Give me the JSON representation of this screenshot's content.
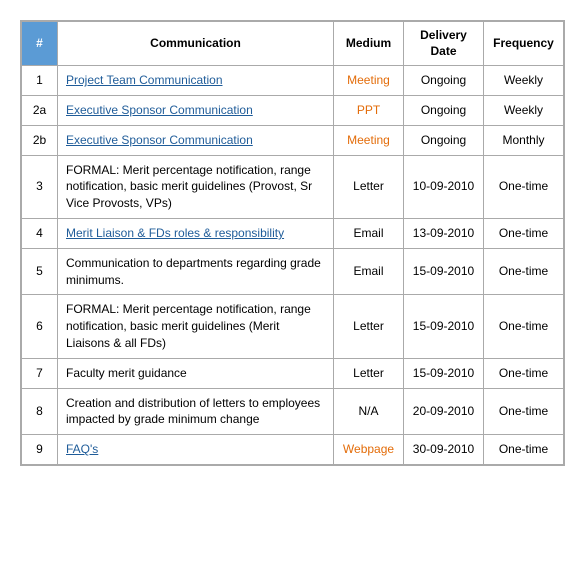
{
  "table": {
    "headers": {
      "num": "#",
      "communication": "Communication",
      "medium": "Medium",
      "delivery_date": "Delivery Date",
      "frequency": "Frequency"
    },
    "rows": [
      {
        "num": "1",
        "communication": "Project Team Communication",
        "communication_style": "link",
        "medium": "Meeting",
        "medium_style": "orange",
        "delivery_date": "Ongoing",
        "frequency": "Weekly"
      },
      {
        "num": "2a",
        "communication": "Executive Sponsor Communication",
        "communication_style": "link",
        "medium": "PPT",
        "medium_style": "orange",
        "delivery_date": "Ongoing",
        "frequency": "Weekly"
      },
      {
        "num": "2b",
        "communication": "Executive Sponsor Communication",
        "communication_style": "link",
        "medium": "Meeting",
        "medium_style": "orange",
        "delivery_date": "Ongoing",
        "frequency": "Monthly"
      },
      {
        "num": "3",
        "communication": "FORMAL: Merit percentage notification, range notification, basic merit guidelines (Provost, Sr Vice Provosts, VPs)",
        "communication_style": "normal",
        "medium": "Letter",
        "medium_style": "normal",
        "delivery_date": "10-09-2010",
        "frequency": "One-time"
      },
      {
        "num": "4",
        "communication": "Merit Liaison & FDs roles & responsibility",
        "communication_style": "link",
        "medium": "Email",
        "medium_style": "normal",
        "delivery_date": "13-09-2010",
        "frequency": "One-time"
      },
      {
        "num": "5",
        "communication": "Communication to departments regarding grade minimums.",
        "communication_style": "normal",
        "medium": "Email",
        "medium_style": "normal",
        "delivery_date": "15-09-2010",
        "frequency": "One-time"
      },
      {
        "num": "6",
        "communication": "FORMAL: Merit percentage notification, range notification, basic merit guidelines (Merit Liaisons & all FDs)",
        "communication_style": "normal",
        "medium": "Letter",
        "medium_style": "normal",
        "delivery_date": "15-09-2010",
        "frequency": "One-time"
      },
      {
        "num": "7",
        "communication": "Faculty merit guidance",
        "communication_style": "normal",
        "medium": "Letter",
        "medium_style": "normal",
        "delivery_date": "15-09-2010",
        "frequency": "One-time"
      },
      {
        "num": "8",
        "communication": "Creation and distribution of letters to employees impacted by grade minimum change",
        "communication_style": "normal",
        "medium": "N/A",
        "medium_style": "normal",
        "delivery_date": "20-09-2010",
        "frequency": "One-time"
      },
      {
        "num": "9",
        "communication": "FAQ's",
        "communication_style": "link",
        "medium": "Webpage",
        "medium_style": "orange",
        "delivery_date": "30-09-2010",
        "frequency": "One-time"
      }
    ]
  }
}
